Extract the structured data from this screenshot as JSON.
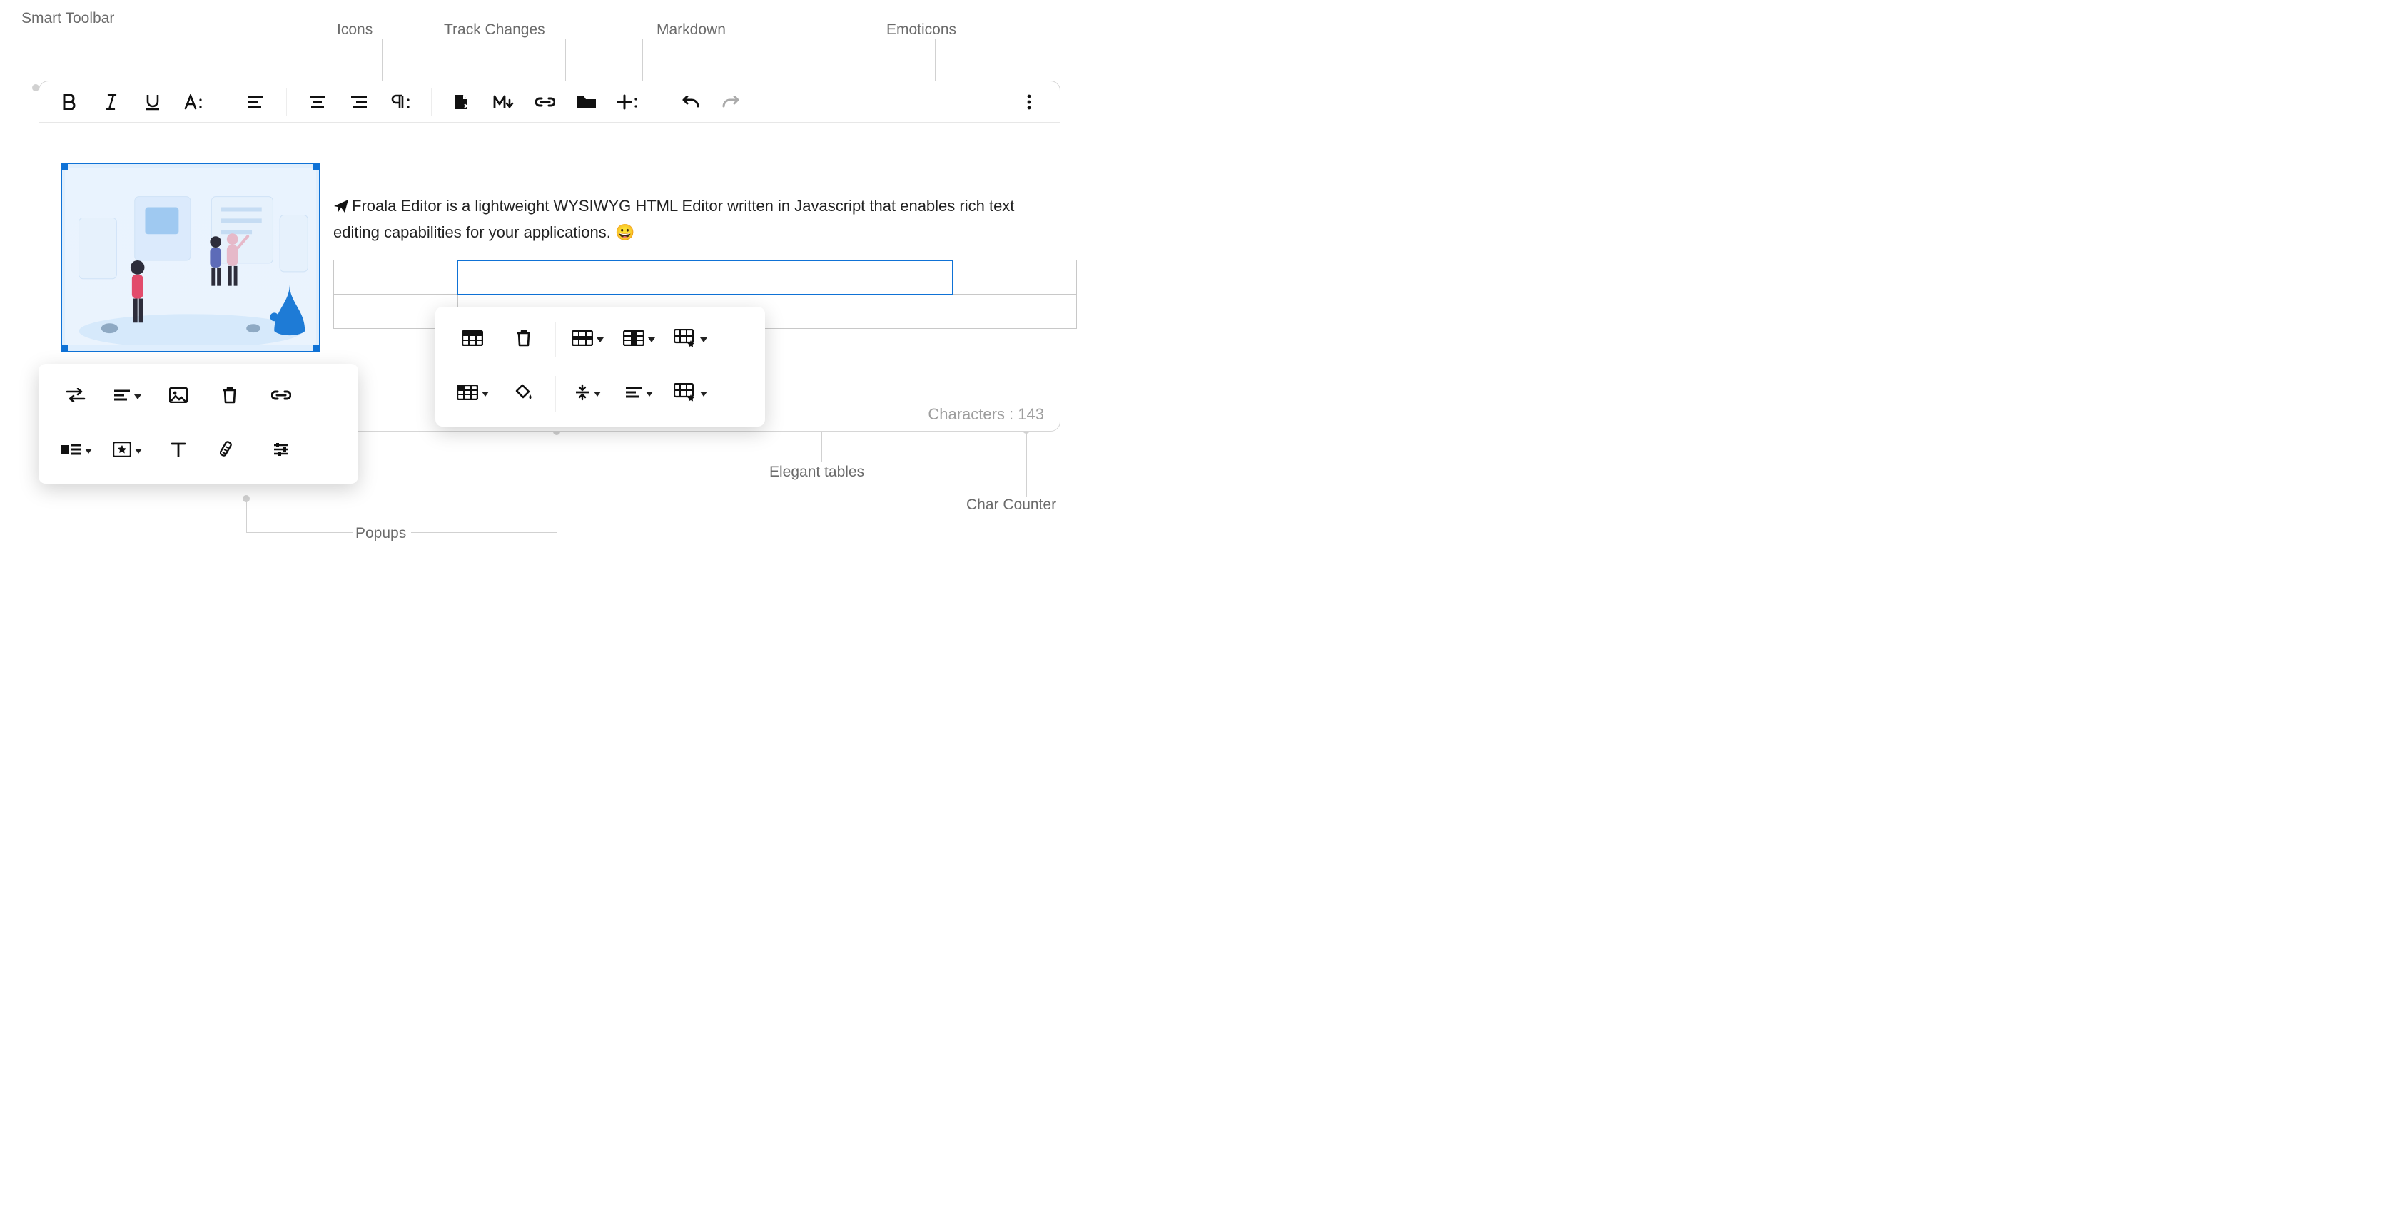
{
  "annotations": {
    "smart_toolbar": "Smart Toolbar",
    "icons": "Icons",
    "track_changes": "Track Changes",
    "markdown": "Markdown",
    "emoticons": "Emoticons",
    "popups": "Popups",
    "elegant_tables": "Elegant tables",
    "char_counter": "Char Counter"
  },
  "paragraph": "Froala Editor is a lightweight WYSIWYG HTML Editor written in Javascript that enables rich text editing capabilities for your applications. ",
  "emoticon": "😀",
  "char_counter_label": "Characters : ",
  "char_counter_value": "143",
  "toolbar": {
    "buttons": [
      "bold",
      "italic",
      "underline",
      "font-style",
      "align-left",
      "align-center",
      "align-right",
      "paragraph-format",
      "track-changes",
      "markdown",
      "link",
      "file-manager",
      "insert-more",
      "undo",
      "redo",
      "more"
    ]
  },
  "image_popup": {
    "row1": [
      "image-replace",
      "image-align",
      "image-caption",
      "image-remove",
      "image-link"
    ],
    "row2": [
      "image-display",
      "image-style",
      "image-alt",
      "image-size",
      "image-advanced"
    ]
  },
  "table_popup": {
    "row1": [
      "table-header",
      "table-remove",
      "table-rows",
      "table-columns",
      "table-style"
    ],
    "row2": [
      "table-cells",
      "table-cell-bg",
      "table-cell-valign",
      "table-cell-halign",
      "table-cell-style"
    ]
  },
  "table": {
    "rows": 2,
    "cols": 3,
    "active": [
      0,
      1
    ]
  }
}
